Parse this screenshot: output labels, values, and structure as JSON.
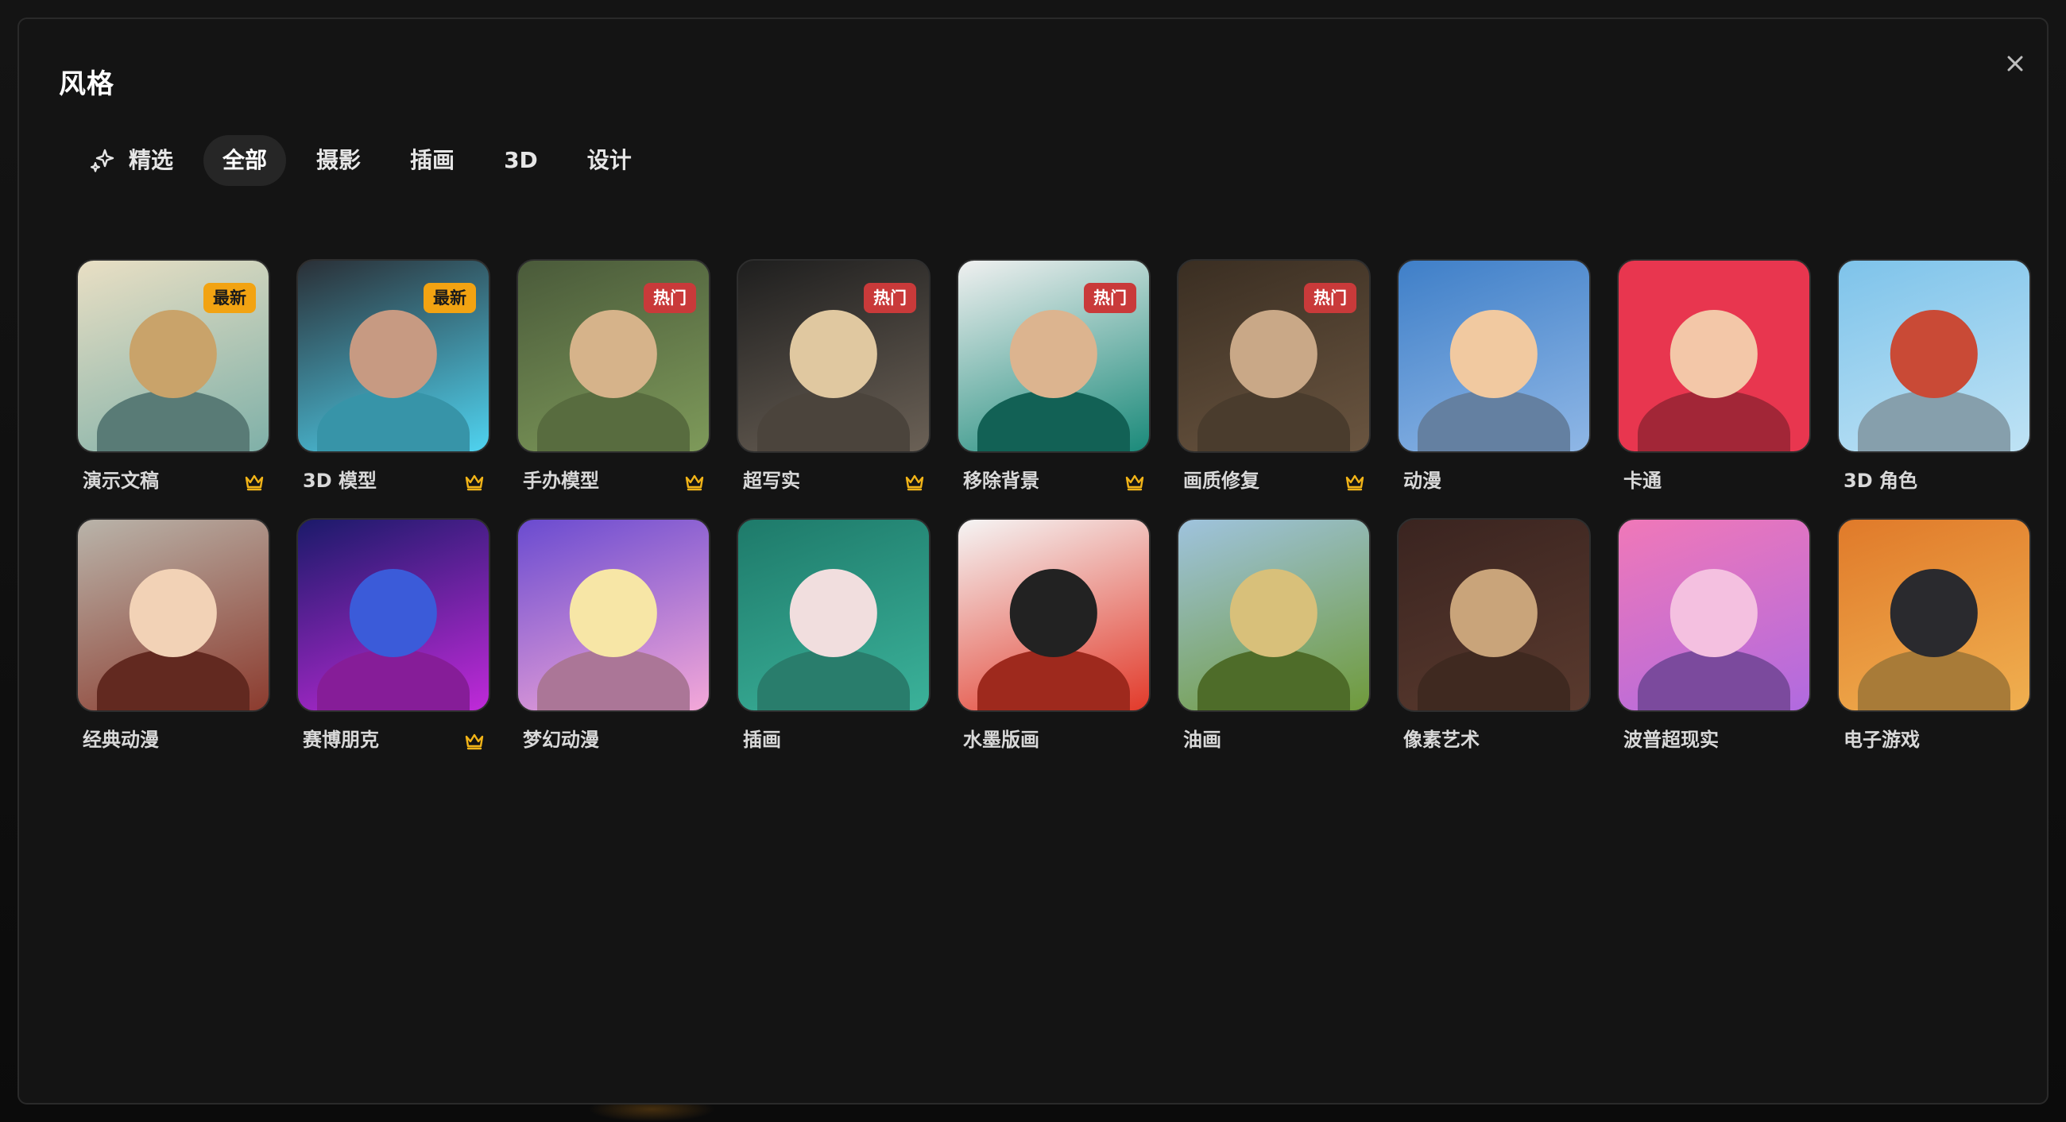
{
  "dialog": {
    "title": "风格",
    "close_icon": "close-icon"
  },
  "tabs": [
    {
      "label": "精选",
      "icon": "sparkles-icon",
      "active": false
    },
    {
      "label": "全部",
      "active": true
    },
    {
      "label": "摄影",
      "active": false
    },
    {
      "label": "插画",
      "active": false
    },
    {
      "label": "3D",
      "active": false
    },
    {
      "label": "设计",
      "active": false
    }
  ],
  "styles": [
    {
      "label": "演示文稿",
      "badge": "最新",
      "badge_type": "new",
      "premium": true,
      "colors": [
        "#e9dfc4",
        "#7fb0a8",
        "#c9a36a"
      ]
    },
    {
      "label": "3D  模型",
      "badge": "最新",
      "badge_type": "new",
      "premium": true,
      "colors": [
        "#2a2f36",
        "#4fd3f0",
        "#c79a82"
      ]
    },
    {
      "label": "手办模型",
      "badge": "热门",
      "badge_type": "hot",
      "premium": true,
      "colors": [
        "#4a5a3a",
        "#7e9a5a",
        "#d6b38a"
      ]
    },
    {
      "label": "超写实",
      "badge": "热门",
      "badge_type": "hot",
      "premium": true,
      "colors": [
        "#1e1e1e",
        "#6b6156",
        "#e0c8a0"
      ]
    },
    {
      "label": "移除背景",
      "badge": "热门",
      "badge_type": "hot",
      "premium": true,
      "colors": [
        "#f0f0f0",
        "#1a8a7a",
        "#dcb48f"
      ]
    },
    {
      "label": "画质修复",
      "badge": "热门",
      "badge_type": "hot",
      "premium": true,
      "colors": [
        "#3a2e22",
        "#6a5540",
        "#c9a887"
      ]
    },
    {
      "label": "动漫",
      "badge": "",
      "badge_type": "",
      "premium": false,
      "colors": [
        "#3f7fc8",
        "#8fb7e6",
        "#f1c9a0"
      ]
    },
    {
      "label": "卡通",
      "badge": "",
      "badge_type": "",
      "premium": false,
      "colors": [
        "#e8364f",
        "#e8364f",
        "#f3c7a8"
      ]
    },
    {
      "label": "3D  角色",
      "badge": "",
      "badge_type": "",
      "premium": false,
      "colors": [
        "#7ec3ea",
        "#bfe3f5",
        "#c94a36"
      ]
    },
    {
      "label": "经典动漫",
      "badge": "",
      "badge_type": "",
      "premium": false,
      "colors": [
        "#b9b4aa",
        "#8c3b2e",
        "#f2d2b6"
      ]
    },
    {
      "label": "赛博朋克",
      "badge": "",
      "badge_type": "",
      "premium": true,
      "colors": [
        "#1b1a6a",
        "#c02ad9",
        "#3b5bd9"
      ]
    },
    {
      "label": "梦幻动漫",
      "badge": "",
      "badge_type": "",
      "premium": false,
      "colors": [
        "#6a4bd0",
        "#f4a8d8",
        "#f7e6a6"
      ]
    },
    {
      "label": "插画",
      "badge": "",
      "badge_type": "",
      "premium": false,
      "colors": [
        "#1e7a6a",
        "#3bb29a",
        "#f1dede"
      ]
    },
    {
      "label": "水墨版画",
      "badge": "",
      "badge_type": "",
      "premium": false,
      "colors": [
        "#f5f5f5",
        "#e23a2a",
        "#222222"
      ]
    },
    {
      "label": "油画",
      "badge": "",
      "badge_type": "",
      "premium": false,
      "colors": [
        "#9fc3de",
        "#6f9a3a",
        "#d8c07a"
      ]
    },
    {
      "label": "像素艺术",
      "badge": "",
      "badge_type": "",
      "premium": false,
      "colors": [
        "#3a2420",
        "#5a3a2e",
        "#c9a47a"
      ]
    },
    {
      "label": "波普超现实",
      "badge": "",
      "badge_type": "",
      "premium": false,
      "colors": [
        "#f078b8",
        "#b06ae0",
        "#f4c0e0"
      ]
    },
    {
      "label": "电子游戏",
      "badge": "",
      "badge_type": "",
      "premium": false,
      "colors": [
        "#e07a2a",
        "#f0b050",
        "#2a2a2e"
      ]
    }
  ],
  "icons": {
    "premium": "crown-icon",
    "featured": "sparkles-icon"
  },
  "accent": {
    "new_badge": "#f2a312",
    "hot_badge": "#c93a3a",
    "crown": "#f2b418"
  }
}
